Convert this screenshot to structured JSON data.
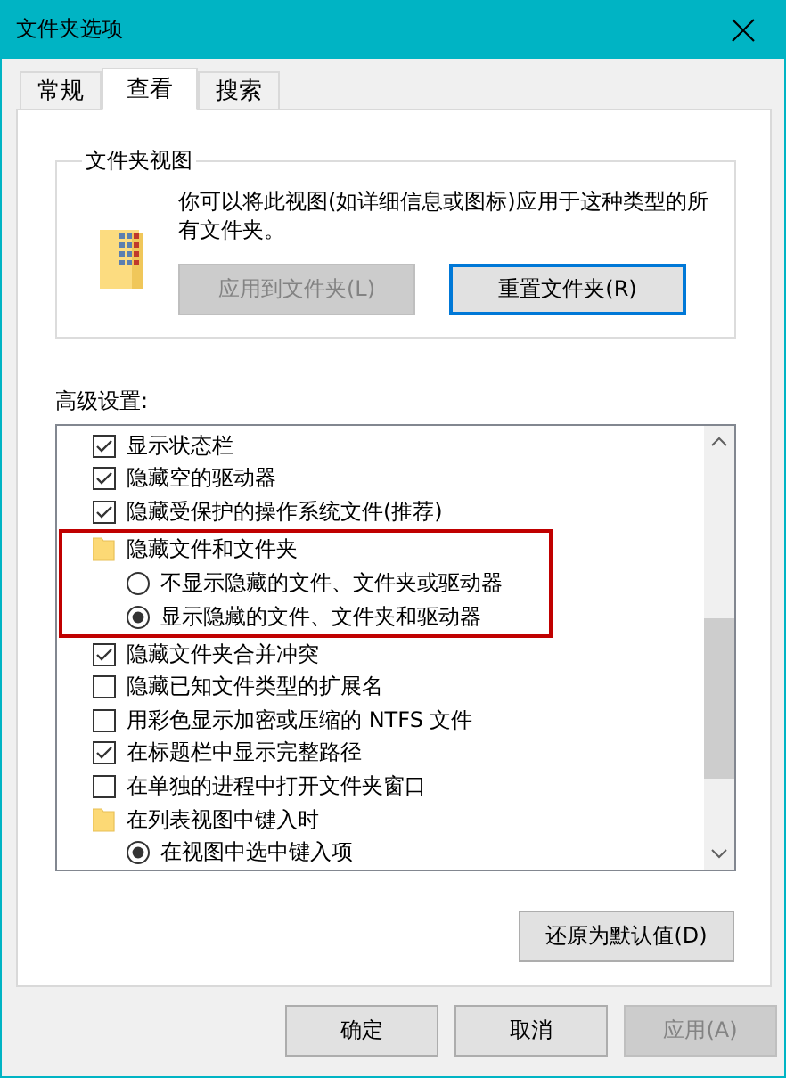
{
  "window": {
    "title": "文件夹选项"
  },
  "tabs": [
    {
      "label": "常规",
      "selected": false
    },
    {
      "label": "查看",
      "selected": true
    },
    {
      "label": "搜索",
      "selected": false
    }
  ],
  "folder_views": {
    "title": "文件夹视图",
    "description": "你可以将此视图(如详细信息或图标)应用于这种类型的所有文件夹。",
    "buttons": [
      {
        "label": "应用到文件夹(L)",
        "disabled": true,
        "focused": false
      },
      {
        "label": "重置文件夹(R)",
        "disabled": false,
        "focused": true
      }
    ]
  },
  "advanced": {
    "label": "高级设置:",
    "items": [
      {
        "kind": "checkbox",
        "label": "显示状态栏",
        "checked": true
      },
      {
        "kind": "checkbox",
        "label": "隐藏空的驱动器",
        "checked": true
      },
      {
        "kind": "checkbox",
        "label": "隐藏受保护的操作系统文件(推荐)",
        "checked": true
      },
      {
        "kind": "folder",
        "label": "隐藏文件和文件夹",
        "highlighted": true,
        "children": [
          {
            "kind": "radio",
            "label": "不显示隐藏的文件、文件夹或驱动器",
            "selected": false
          },
          {
            "kind": "radio",
            "label": "显示隐藏的文件、文件夹和驱动器",
            "selected": true
          }
        ]
      },
      {
        "kind": "checkbox",
        "label": "隐藏文件夹合并冲突",
        "checked": true
      },
      {
        "kind": "checkbox",
        "label": "隐藏已知文件类型的扩展名",
        "checked": false
      },
      {
        "kind": "checkbox",
        "label": "用彩色显示加密或压缩的 NTFS 文件",
        "checked": false
      },
      {
        "kind": "checkbox",
        "label": "在标题栏中显示完整路径",
        "checked": true
      },
      {
        "kind": "checkbox",
        "label": "在单独的进程中打开文件夹窗口",
        "checked": false
      },
      {
        "kind": "folder",
        "label": "在列表视图中键入时",
        "children": [
          {
            "kind": "radio",
            "label": "在视图中选中键入项",
            "selected": true
          }
        ]
      }
    ],
    "restore_button": "还原为默认值(D)"
  },
  "buttons": [
    {
      "label": "确定",
      "disabled": false
    },
    {
      "label": "取消",
      "disabled": false
    },
    {
      "label": "应用(A)",
      "disabled": true
    }
  ]
}
